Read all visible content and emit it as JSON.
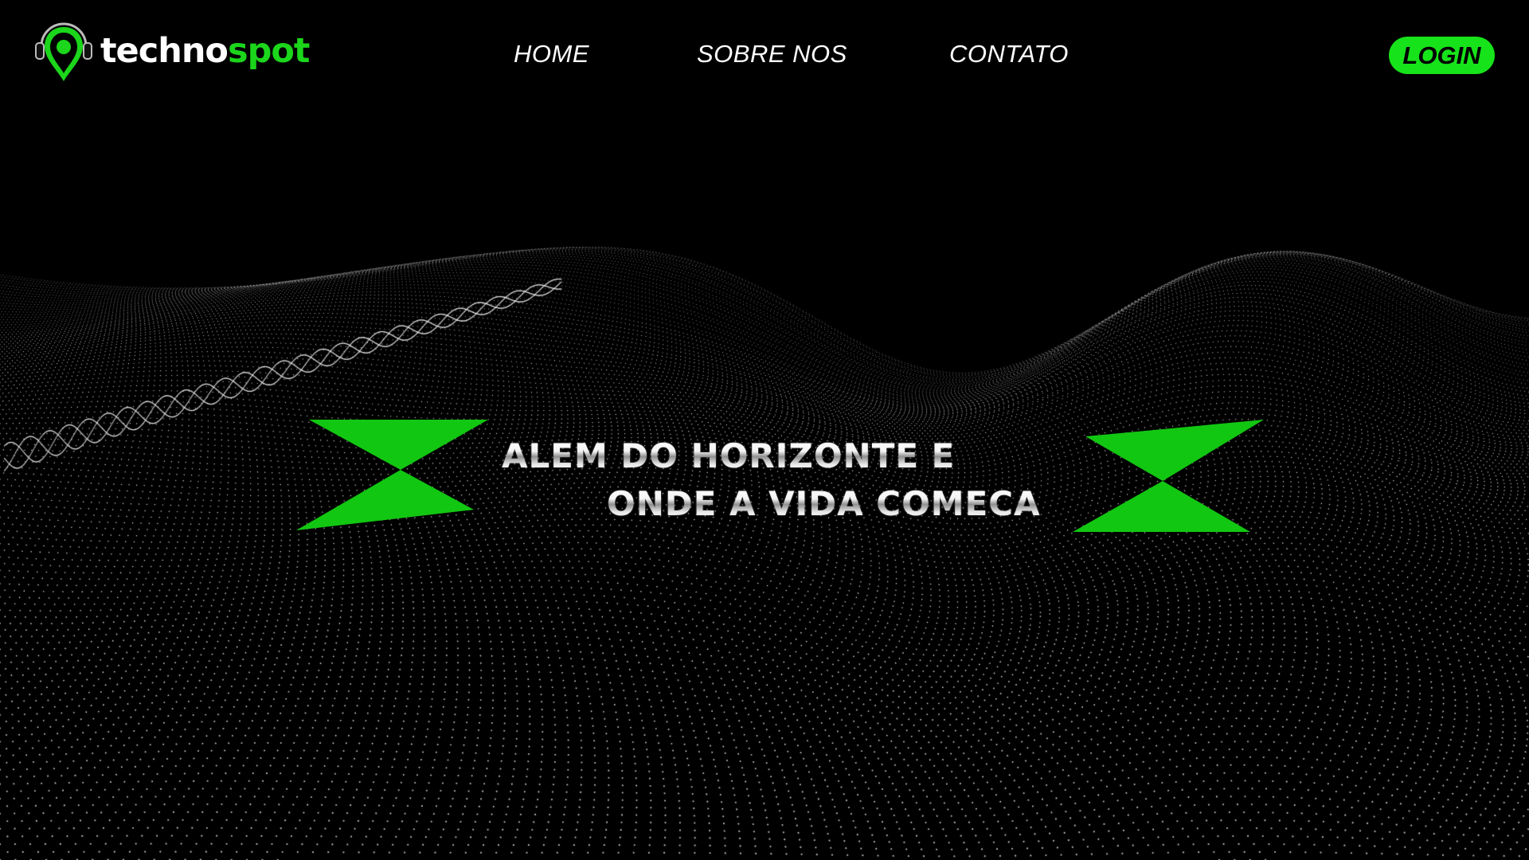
{
  "brand": {
    "name_part1": "techno",
    "name_part2": "spot",
    "logo_icon": "location-pin-headphones-icon",
    "accent_color": "#1bd61b"
  },
  "nav": {
    "items": [
      {
        "label": "HOME"
      },
      {
        "label": "SOBRE NOS"
      },
      {
        "label": "CONTATO"
      }
    ],
    "login_label": "LOGIN",
    "login_color": "#17e31a"
  },
  "hero": {
    "line1": "ALEM DO HORIZONTE E",
    "line2": "ONDE A VIDA COMECA",
    "decor_color": "#12c712",
    "background": "dotted-wave-landscape"
  }
}
